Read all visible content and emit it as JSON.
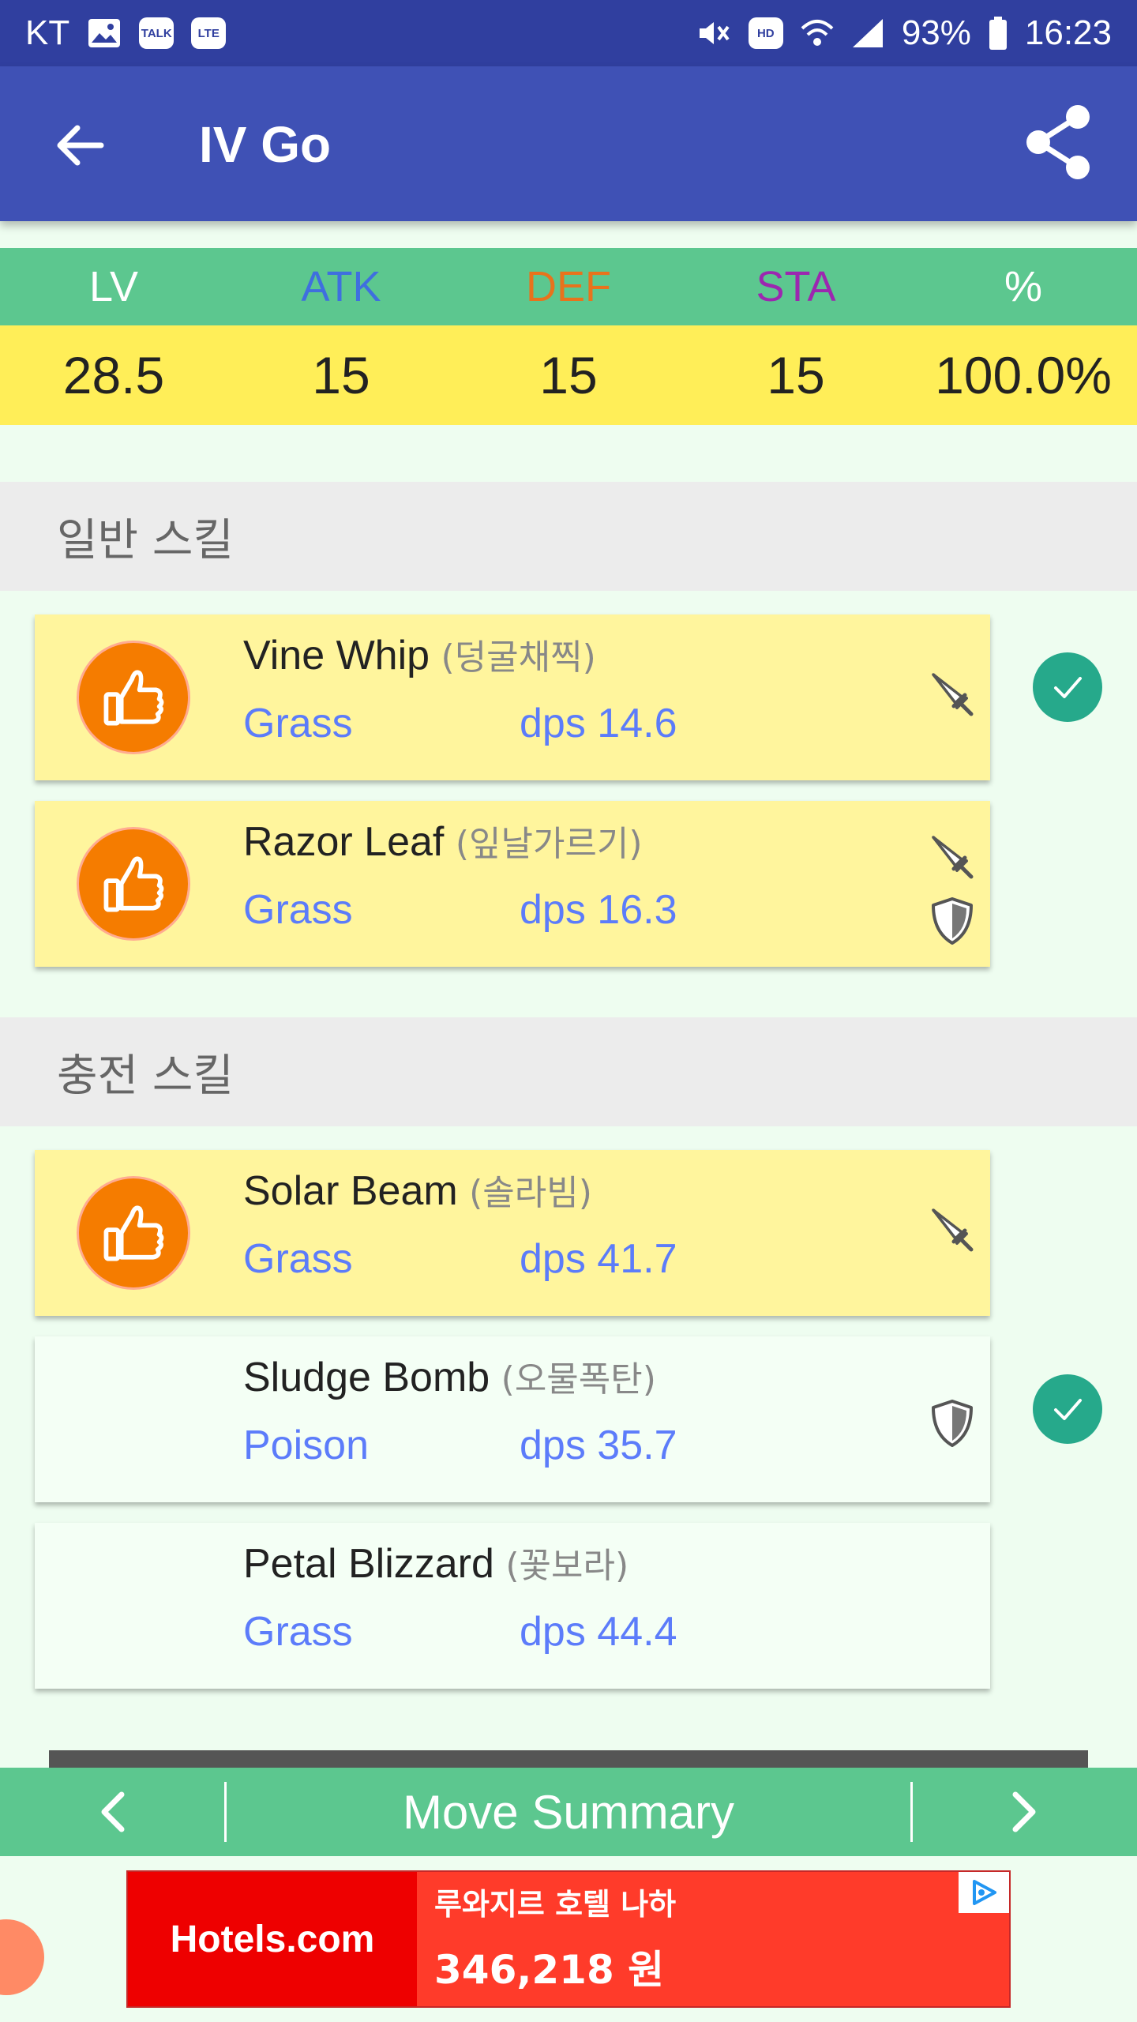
{
  "status_bar": {
    "carrier": "KT",
    "talk_badge": "TALK",
    "lte_badge": "LTE",
    "hd_badge": "HD",
    "battery": "93%",
    "time": "16:23"
  },
  "app_bar": {
    "title": "IV Go"
  },
  "iv": {
    "headers": [
      {
        "label": "LV",
        "color": "#ffffff"
      },
      {
        "label": "ATK",
        "color": "#3f6fdf"
      },
      {
        "label": "DEF",
        "color": "#e8731c"
      },
      {
        "label": "STA",
        "color": "#9c27b0"
      },
      {
        "label": "%",
        "color": "#ffffff"
      }
    ],
    "values": [
      "28.5",
      "15",
      "15",
      "15",
      "100.0%"
    ]
  },
  "sections": {
    "fast": "일반 스킬",
    "charge": "충전 스킬"
  },
  "moves": [
    {
      "name": "Vine Whip",
      "kr": "(덩굴채찍)",
      "type": "Grass",
      "dps": "dps 14.6",
      "recommended": true,
      "attack": true,
      "defense": false,
      "selected": true
    },
    {
      "name": "Razor Leaf",
      "kr": "(잎날가르기)",
      "type": "Grass",
      "dps": "dps 16.3",
      "recommended": true,
      "attack": true,
      "defense": true,
      "selected": false
    },
    {
      "name": "Solar Beam",
      "kr": "(솔라빔)",
      "type": "Grass",
      "dps": "dps 41.7",
      "recommended": true,
      "attack": true,
      "defense": false,
      "selected": false
    },
    {
      "name": "Sludge Bomb",
      "kr": "(오물폭탄)",
      "type": "Poison",
      "dps": "dps 35.7",
      "recommended": false,
      "attack": false,
      "defense": true,
      "selected": true
    },
    {
      "name": "Petal Blizzard",
      "kr": "(꽃보라)",
      "type": "Grass",
      "dps": "dps 44.4",
      "recommended": false,
      "attack": false,
      "defense": false,
      "selected": false
    }
  ],
  "bottom_nav": {
    "prev_icon": "chevron-left-icon",
    "title": "Move Summary",
    "next_icon": "chevron-right-icon"
  },
  "ad": {
    "logo": "Hotels.com",
    "hotel": "루와지르 호텔 나하",
    "price": "346,218 원"
  },
  "colors": {
    "status_bar": "#303f9f",
    "app_bar": "#3f51b5",
    "iv_header": "#5cc78f",
    "iv_values": "#ffee58",
    "recommended_card": "#fff59d",
    "type_text": "#5c7cfa",
    "check": "#26a98b"
  }
}
